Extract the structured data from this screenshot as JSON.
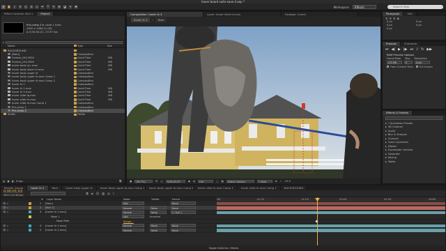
{
  "window_title": "hover board suite-save 4.aep *",
  "workspace": {
    "label": "Workspace:",
    "value": "Effects"
  },
  "search": {
    "placeholder": "Search Help"
  },
  "project_panel": {
    "tabs": [
      "Effect Controls: Null 1",
      "Project"
    ],
    "preview": {
      "name": "Pre-comp 2 ▾",
      "used": ", used 1 time",
      "dims": "1920 x 1080 (1.00)",
      "duration": "Δ 0;00;04;21, 23.97 fps"
    },
    "columns": {
      "name": "Name",
      "type": "Type",
      "size": "Size"
    },
    "items": [
      {
        "name": "BACKGROUND",
        "type": "",
        "size": "",
        "kind": "folder",
        "color": "#c9a04a"
      },
      {
        "name": "[Ram]",
        "type": "Composition",
        "size": "",
        "kind": "comp",
        "color": "#c9a04a"
      },
      {
        "name": "Frames_001.MOV",
        "type": "QuickTime",
        "size": "MB",
        "kind": "footage",
        "color": "#c9a04a"
      },
      {
        "name": "Frames_010.MOV",
        "type": "QuickTime",
        "size": "MB",
        "kind": "footage",
        "color": "#c9a04a"
      },
      {
        "name": "hover body up .mov",
        "type": "QuickTime",
        "size": "MB",
        "kind": "footage",
        "color": "#c9a04a"
      },
      {
        "name": "hover body lower fx.mov",
        "type": "QuickTime",
        "size": "MB",
        "kind": "footage",
        "color": "#c9a04a"
      },
      {
        "name": "hover body upper fx",
        "type": "Composition",
        "size": "",
        "kind": "comp",
        "color": "#c9a04a"
      },
      {
        "name": "hover body upper fx.mov Comp 1",
        "type": "Composition",
        "size": "",
        "kind": "comp",
        "color": "#c9a04a"
      },
      {
        "name": "hover body upper fx.mov Comp 2",
        "type": "Composition",
        "size": "",
        "kind": "comp",
        "color": "#c9a04a"
      },
      {
        "name": "hover fx 2",
        "type": "Composition",
        "size": "",
        "kind": "comp",
        "color": "#c9a04a"
      },
      {
        "name": "hover fx 1.mov",
        "type": "QuickTime",
        "size": "MB",
        "kind": "footage",
        "color": "#c9a04a"
      },
      {
        "name": "hover fx 2.mov",
        "type": "QuickTime",
        "size": "MB",
        "kind": "footage",
        "color": "#c9a04a"
      },
      {
        "name": "hover slide fg.mov",
        "type": "QuickTime",
        "size": "MB",
        "kind": "footage",
        "color": "#c9a04a"
      },
      {
        "name": "hover slide fx.mov",
        "type": "QuickTime",
        "size": "MB",
        "kind": "footage",
        "color": "#c9a04a"
      },
      {
        "name": "hover slide fx.mov Comp 1",
        "type": "Composition",
        "size": "",
        "kind": "comp",
        "color": "#c9a04a"
      },
      {
        "name": "Pre-comp 1",
        "type": "Composition",
        "size": "",
        "kind": "comp",
        "color": "#c9a04a"
      },
      {
        "name": "Pre-comp 2",
        "type": "Composition",
        "size": "",
        "kind": "comp",
        "color": "#c9a04a",
        "selected": true
      },
      {
        "name": "Solids",
        "type": "Folder",
        "size": "",
        "kind": "folder",
        "color": "#c9a04a"
      }
    ],
    "footer": "8 bpc"
  },
  "composition": {
    "tabs": [
      "Composition: hover fx 2",
      "Layer: hover slide fx.mov",
      "Footage: (none)"
    ],
    "breadcrumbs": [
      "hover fx 2",
      "Ram"
    ],
    "footer": {
      "zoom": "(92.7%)",
      "timecode": "0;00;01;03",
      "quality": "Full",
      "camera": "Active Camera",
      "view": "1 View",
      "offset": "+0.0"
    }
  },
  "right_panel": {
    "tabs_top": [
      "Paragraph",
      "Info"
    ],
    "para_values": [
      "0 px",
      "0 px",
      "0 px",
      "0 px",
      "0 px"
    ],
    "tabs_preview": [
      "Preview",
      "Character"
    ],
    "ram_options": "RAM Preview Options",
    "frame_rate_label": "Frame Rate",
    "skip_label": "Skip",
    "resolution_label": "Resolution",
    "frame_rate": "(23.98)",
    "skip": "0",
    "resolution": "Auto",
    "from_current": "From Current Time",
    "full_screen": "Full Screen",
    "effects_title": "Effects & Presets",
    "effects": [
      "* Animation Presets",
      "3D Channel",
      "Audio",
      "Blur & Sharpen",
      "Channel",
      "Color Correction",
      "Distort",
      "Expression Controls",
      "Generate",
      "Keying",
      "Matte"
    ]
  },
  "timeline": {
    "tabs": [
      "Render Queue",
      "hover fx 2",
      "Ram",
      "hover body upper fx",
      "hover body upper fx.mov Comp 1",
      "hover body upper fx.mov Comp 2",
      "hover slide fx.mov Comp 1",
      "hover slide fx.mov Comp 1",
      "BACKGROUND"
    ],
    "timecode": "0;00;01;03",
    "frames": "00027 (23.98 fps)",
    "columns": {
      "num": "#",
      "layer": "Layer Name",
      "mode": "Mode",
      "trkmat": "TrkMat",
      "parent": "Parent"
    },
    "layers": [
      {
        "num": "1",
        "name": "[Ram]",
        "mode": "Add",
        "trkmat": "",
        "parent": "None",
        "color": "#c9a04a",
        "bar": "#8e4d45"
      },
      {
        "num": "2",
        "name": "[Null 1]",
        "mode": "Normal",
        "trkmat": "None",
        "parent": "None",
        "color": "#c9a04a",
        "bar": "#b56a62",
        "selected": true
      },
      {
        "num": "3",
        "name": "[hover fx 2.mov]",
        "mode": "Normal",
        "trkmat": "None",
        "parent": "2. Null 1",
        "color": "#4aa3b8",
        "bar": "#6aa0a8"
      },
      {
        "num": "",
        "name": "Mask 1",
        "mode": "Add",
        "trkmat": "Inverted",
        "parent": "",
        "color": "#c9c94a",
        "bar": ""
      },
      {
        "num": "",
        "name": "Mask Path",
        "mode": "",
        "trkmat": "",
        "parent": "",
        "color": "",
        "bar": ""
      },
      {
        "num": "4",
        "name": "[hover fx 1.mov]",
        "mode": "Normal",
        "trkmat": "None",
        "parent": "None",
        "color": "#4aa3b8",
        "bar": "#6aa0a8"
      },
      {
        "num": "5",
        "name": "[hover fx 2.mov]",
        "mode": "Normal",
        "trkmat": "None",
        "parent": "None",
        "color": "#4aa3b8",
        "bar": "#6aa0a8"
      }
    ],
    "mask_shape": "Shape...",
    "ruler_ticks": [
      "00f",
      "01:12f",
      "01:12f",
      "02:00f",
      "03:12f",
      "04:00f"
    ],
    "footer": "Toggle Switches / Modes"
  }
}
